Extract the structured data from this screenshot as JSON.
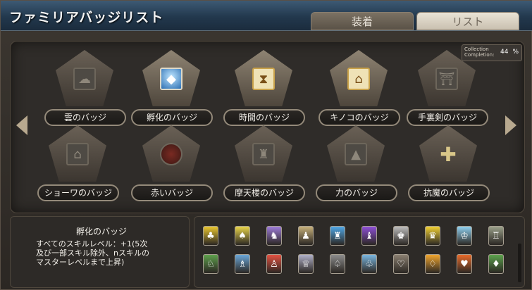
{
  "window": {
    "title": "ファミリアバッジリスト"
  },
  "tabs": [
    {
      "label": "装着",
      "selected": false
    },
    {
      "label": "リスト",
      "selected": true
    }
  ],
  "completion": {
    "label_line1": "Collection",
    "label_line2": "Completion:",
    "value": "44",
    "unit": "%"
  },
  "badges": [
    {
      "name": "雲のバッジ",
      "icon": "cloud-icon",
      "active": false
    },
    {
      "name": "孵化のバッジ",
      "icon": "egg-icon",
      "active": true
    },
    {
      "name": "時間のバッジ",
      "icon": "hourglass-icon",
      "active": true
    },
    {
      "name": "キノコのバッジ",
      "icon": "house-icon",
      "active": true
    },
    {
      "name": "手裏剣のバッジ",
      "icon": "gate-icon",
      "active": false
    },
    {
      "name": "ショーワのバッジ",
      "icon": "shrine-icon",
      "active": false
    },
    {
      "name": "赤いバッジ",
      "icon": "red-orb-icon",
      "active": false
    },
    {
      "name": "摩天楼のバッジ",
      "icon": "castle-icon",
      "active": false
    },
    {
      "name": "力のバッジ",
      "icon": "pagoda-icon",
      "active": false
    },
    {
      "name": "抗魔のバッジ",
      "icon": "cross-icon",
      "active": false
    }
  ],
  "description": {
    "title": "孵化のバッジ",
    "lines": [
      "すべてのスキルレベル：+1(5次",
      "及び一部スキル除外、nスキルの",
      "マスターレベルまで上昇)"
    ]
  },
  "familiars": [
    {
      "icon": "familiar-1-icon",
      "color": "#e9c62f",
      "glyph": "♣"
    },
    {
      "icon": "familiar-2-icon",
      "color": "#e8d44a",
      "glyph": "♠"
    },
    {
      "icon": "familiar-3-icon",
      "color": "#9d7bd8",
      "glyph": "♞"
    },
    {
      "icon": "familiar-4-icon",
      "color": "#c6b07a",
      "glyph": "♟"
    },
    {
      "icon": "familiar-5-icon",
      "color": "#4fa7e6",
      "glyph": "♜"
    },
    {
      "icon": "familiar-6-icon",
      "color": "#8d4fd6",
      "glyph": "♝"
    },
    {
      "icon": "familiar-7-icon",
      "color": "#bdbdbd",
      "glyph": "♚"
    },
    {
      "icon": "familiar-8-icon",
      "color": "#f1d033",
      "glyph": "♛"
    },
    {
      "icon": "familiar-9-icon",
      "color": "#8fd0f0",
      "glyph": "♔"
    },
    {
      "icon": "familiar-10-icon",
      "color": "#9aa08a",
      "glyph": "♖"
    },
    {
      "icon": "familiar-11-icon",
      "color": "#5ea04c",
      "glyph": "♘"
    },
    {
      "icon": "familiar-12-icon",
      "color": "#6aa7d8",
      "glyph": "♗"
    },
    {
      "icon": "familiar-13-icon",
      "color": "#e25141",
      "glyph": "♙"
    },
    {
      "icon": "familiar-14-icon",
      "color": "#b0b0c8",
      "glyph": "♕"
    },
    {
      "icon": "familiar-15-icon",
      "color": "#8c8c8c",
      "glyph": "♤"
    },
    {
      "icon": "familiar-16-icon",
      "color": "#7ab7e0",
      "glyph": "♧"
    },
    {
      "icon": "familiar-17-icon",
      "color": "#8a7f70",
      "glyph": "♡"
    },
    {
      "icon": "familiar-18-icon",
      "color": "#f0a52e",
      "glyph": "♢"
    },
    {
      "icon": "familiar-19-icon",
      "color": "#e86a2a",
      "glyph": "♥"
    },
    {
      "icon": "familiar-20-icon",
      "color": "#5da34d",
      "glyph": "♦"
    }
  ]
}
